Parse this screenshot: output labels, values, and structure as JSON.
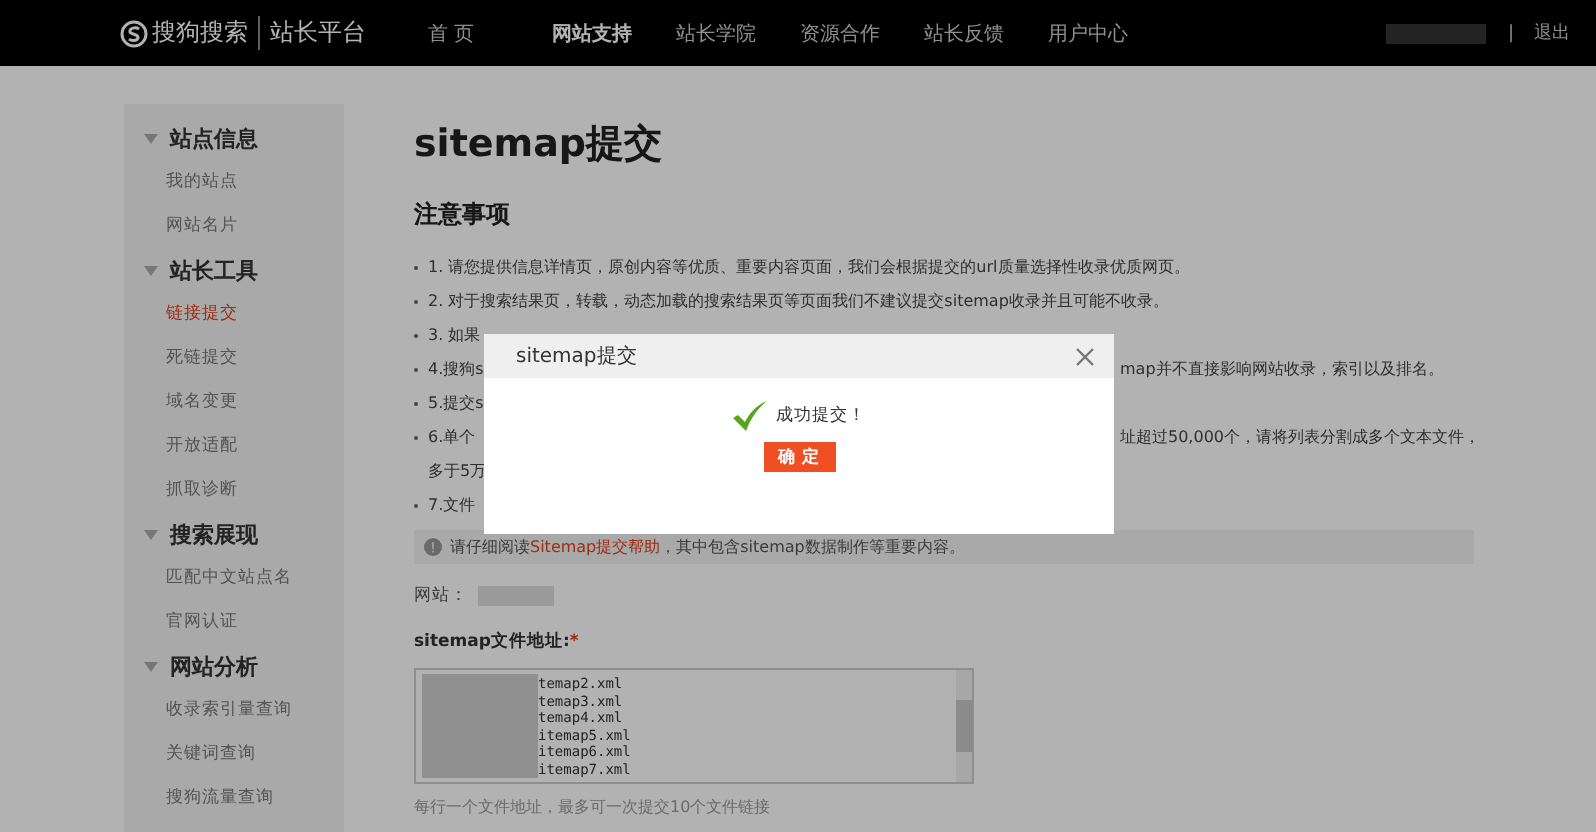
{
  "header": {
    "logo": "搜狗搜索",
    "platform": "站长平台",
    "nav": [
      {
        "label": "首 页",
        "selected": false
      },
      {
        "label": "网站支持",
        "selected": true
      },
      {
        "label": "站长学院",
        "selected": false
      },
      {
        "label": "资源合作",
        "selected": false
      },
      {
        "label": "站长反馈",
        "selected": false
      },
      {
        "label": "用户中心",
        "selected": false
      }
    ],
    "separator": "|",
    "logout": "退出"
  },
  "sidebar": {
    "groups": [
      {
        "title": "站点信息",
        "expanded": true,
        "items": [
          {
            "label": "我的站点",
            "selected": false
          },
          {
            "label": "网站名片",
            "selected": false
          }
        ]
      },
      {
        "title": "站长工具",
        "expanded": true,
        "items": [
          {
            "label": "链接提交",
            "selected": true
          },
          {
            "label": "死链提交",
            "selected": false
          },
          {
            "label": "域名变更",
            "selected": false
          },
          {
            "label": "开放适配",
            "selected": false
          },
          {
            "label": "抓取诊断",
            "selected": false
          }
        ]
      },
      {
        "title": "搜索展现",
        "expanded": true,
        "items": [
          {
            "label": "匹配中文站点名",
            "selected": false
          },
          {
            "label": "官网认证",
            "selected": false
          }
        ]
      },
      {
        "title": "网站分析",
        "expanded": true,
        "items": [
          {
            "label": "收录索引量查询",
            "selected": false
          },
          {
            "label": "关键词查询",
            "selected": false
          },
          {
            "label": "搜狗流量查询",
            "selected": false
          }
        ]
      }
    ]
  },
  "main": {
    "title": "sitemap提交",
    "notes_title": "注意事项",
    "notes": [
      {
        "left": "1. 请您提供信息详情页，原创内容等优质、重要内容页面，我们会根据提交的url质量选择性收录优质网页。"
      },
      {
        "left": "2. 对于搜索结果页，转载，动态加载的搜索结果页等页面我们不建议提交sitemap收录并且可能不收录。"
      },
      {
        "left": "3. 如果"
      },
      {
        "left": "4.搜狗s",
        "right": "map并不直接影响网站收录，索引以及排名。"
      },
      {
        "left": "5.提交s"
      },
      {
        "left": "6.单个",
        "right": "址超过50,000个，请将列表分割成多个文本文件，",
        "continued": "多于5万"
      },
      {
        "left": "7.文件"
      }
    ],
    "notice": {
      "before": "请仔细阅读",
      "link": "Sitemap提交帮助",
      "after": "，其中包含sitemap数据制作等重要内容。"
    },
    "site_label": "网站：",
    "sitemap_label": "sitemap文件地址:",
    "required_mark": "*",
    "sitemap_lines": [
      "temap2.xml",
      "temap3.xml",
      "temap4.xml",
      "itemap5.xml",
      "itemap6.xml",
      "itemap7.xml"
    ],
    "hint": "每行一个文件地址，最多可一次提交10个文件链接"
  },
  "dialog": {
    "title": "sitemap提交",
    "message": "成功提交！",
    "button": "确 定"
  }
}
